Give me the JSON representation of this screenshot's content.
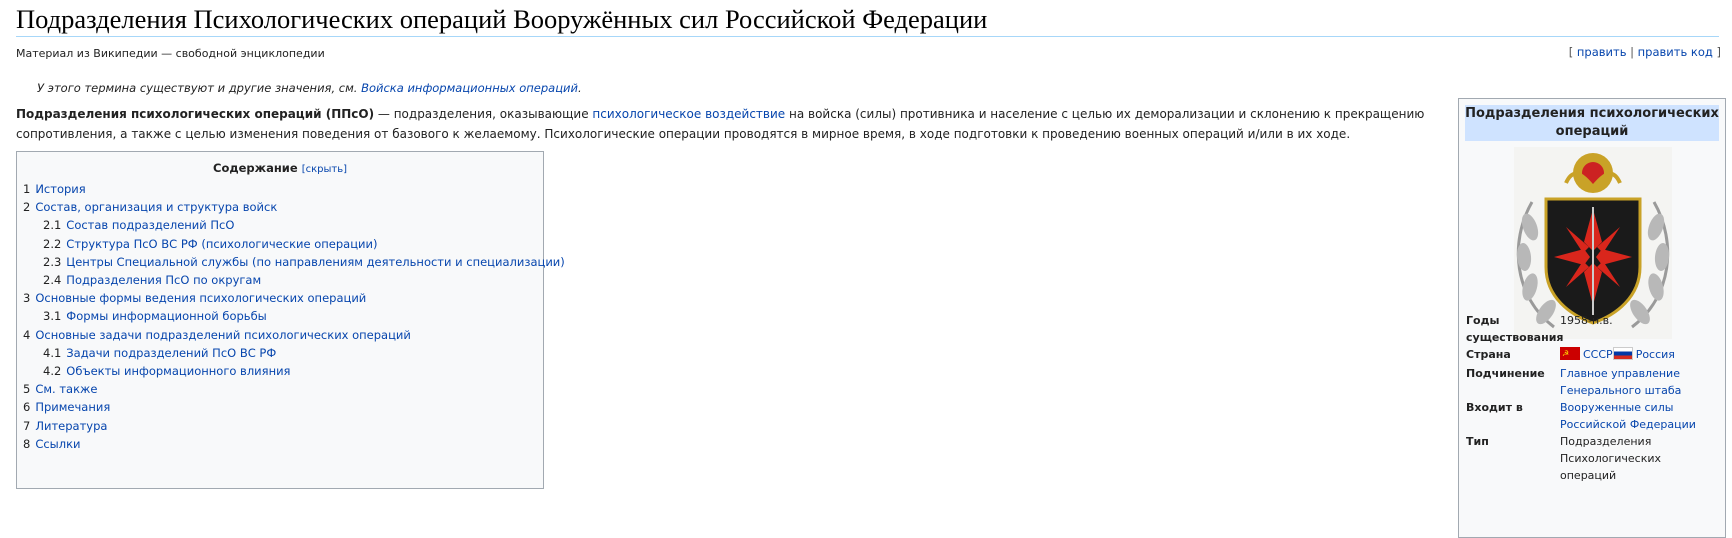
{
  "article": {
    "title": "Подразделения Психологических операций Вооружённых сил Российской Федерации",
    "tagline": "Материал из Википедии — свободной энциклопедии",
    "edit_links": {
      "open": "[ ",
      "edit": "править",
      "sep": " | ",
      "edit_source": "править код",
      "close": " ]"
    },
    "hatnote": {
      "text": "У этого термина существуют и другие значения, см. ",
      "link": "Войска информационных операций",
      "end": "."
    },
    "intro": {
      "bold": "Подразделения психологических операций",
      "abbr": " (ППсО)",
      "text_1": " — подразделения, оказывающие ",
      "link_1": "психологическое воздействие",
      "text_2": " на войска (силы) противника и население с целью их деморализации и склонению к прекращению сопротивления, а также с целью изменения поведения от базового к желаемому. Психологические операции проводятся в мирное время, в ходе подготовки к проведению военных операций и/или в их ходе."
    }
  },
  "toc": {
    "title": "Содержание",
    "toggle": "[скрыть]",
    "items": [
      {
        "num": "1",
        "label": "История"
      },
      {
        "num": "2",
        "label": "Состав, организация и структура войск"
      },
      {
        "num": "2.1",
        "label": "Состав подразделений ПсО"
      },
      {
        "num": "2.2",
        "label": "Структура ПсО ВС РФ (психологические операции)"
      },
      {
        "num": "2.3",
        "label": "Центры Специальной службы (по направлениям деятельности и специализации)"
      },
      {
        "num": "2.4",
        "label": "Подразделения ПсО по округам"
      },
      {
        "num": "3",
        "label": "Основные формы ведения психологических операций"
      },
      {
        "num": "3.1",
        "label": "Формы информационной борьбы"
      },
      {
        "num": "4",
        "label": "Основные задачи подразделений психологических операций"
      },
      {
        "num": "4.1",
        "label": "Задачи подразделений ПсО ВС РФ"
      },
      {
        "num": "4.2",
        "label": "Объекты информационного влияния"
      },
      {
        "num": "5",
        "label": "См. также"
      },
      {
        "num": "6",
        "label": "Примечания"
      },
      {
        "num": "7",
        "label": "Литература"
      },
      {
        "num": "8",
        "label": "Ссылки"
      }
    ]
  },
  "infobox": {
    "title": "Подразделения психологических операций",
    "rows": {
      "years": {
        "label": "Годы существования",
        "value": "1958-н.в."
      },
      "country": {
        "label": "Страна",
        "value_1": "СССР",
        "value_2": "Россия"
      },
      "subordination": {
        "label": "Подчинение",
        "value": "Главное управление Генерального штаба"
      },
      "part_of": {
        "label": "Входит в",
        "value": "Вооруженные силы Российской Федерации"
      },
      "type": {
        "label": "Тип",
        "value": "Подразделения Психологических операций"
      }
    }
  },
  "colors": {
    "link": "#0645ad",
    "infobox_header": "#cfe3ff",
    "box_border": "#a2a9b1",
    "box_bg": "#f8f9fa"
  }
}
